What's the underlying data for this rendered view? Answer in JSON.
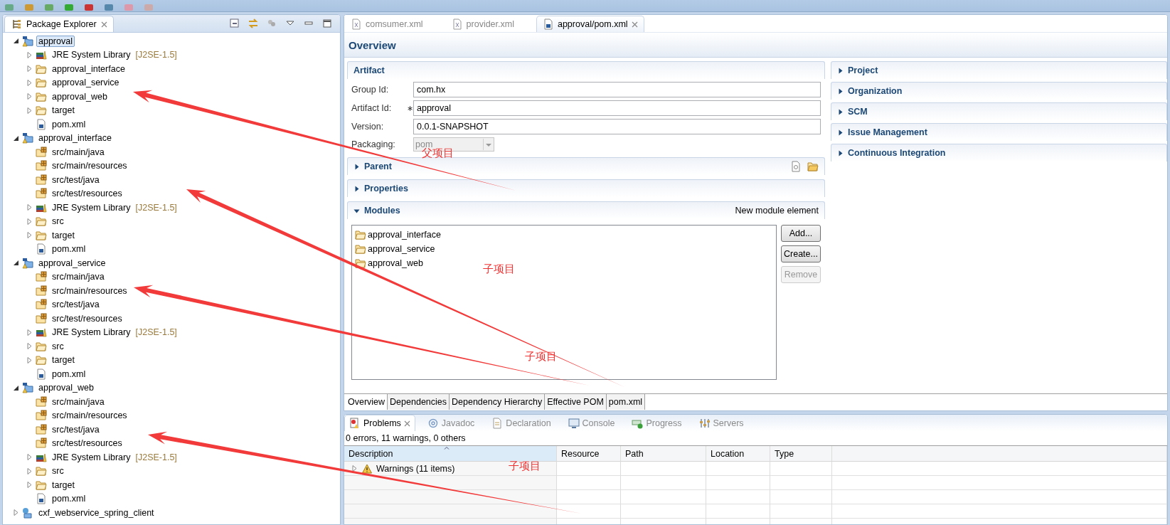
{
  "package_explorer": {
    "title": "Package Explorer",
    "tree": [
      {
        "label": "approval",
        "kind": "project",
        "expanded": true,
        "selected": true,
        "children": [
          {
            "label": "JRE System Library",
            "suffix": "[J2SE-1.5]",
            "kind": "library",
            "expanded": false
          },
          {
            "label": "approval_interface",
            "kind": "folder",
            "expanded": false
          },
          {
            "label": "approval_service",
            "kind": "folder",
            "expanded": false
          },
          {
            "label": "approval_web",
            "kind": "folder",
            "expanded": false
          },
          {
            "label": "target",
            "kind": "folder",
            "expanded": false
          },
          {
            "label": "pom.xml",
            "kind": "pom"
          }
        ]
      },
      {
        "label": "approval_interface",
        "kind": "project",
        "expanded": true,
        "selected": false,
        "children": [
          {
            "label": "src/main/java",
            "kind": "source"
          },
          {
            "label": "src/main/resources",
            "kind": "source"
          },
          {
            "label": "src/test/java",
            "kind": "source"
          },
          {
            "label": "src/test/resources",
            "kind": "source"
          },
          {
            "label": "JRE System Library",
            "suffix": "[J2SE-1.5]",
            "kind": "library",
            "expanded": false
          },
          {
            "label": "src",
            "kind": "folder",
            "expanded": false
          },
          {
            "label": "target",
            "kind": "folder",
            "expanded": false
          },
          {
            "label": "pom.xml",
            "kind": "pom"
          }
        ]
      },
      {
        "label": "approval_service",
        "kind": "project",
        "expanded": true,
        "selected": false,
        "children": [
          {
            "label": "src/main/java",
            "kind": "source"
          },
          {
            "label": "src/main/resources",
            "kind": "source"
          },
          {
            "label": "src/test/java",
            "kind": "source"
          },
          {
            "label": "src/test/resources",
            "kind": "source"
          },
          {
            "label": "JRE System Library",
            "suffix": "[J2SE-1.5]",
            "kind": "library",
            "expanded": false
          },
          {
            "label": "src",
            "kind": "folder",
            "expanded": false
          },
          {
            "label": "target",
            "kind": "folder",
            "expanded": false
          },
          {
            "label": "pom.xml",
            "kind": "pom"
          }
        ]
      },
      {
        "label": "approval_web",
        "kind": "project",
        "expanded": true,
        "selected": false,
        "children": [
          {
            "label": "src/main/java",
            "kind": "source"
          },
          {
            "label": "src/main/resources",
            "kind": "source"
          },
          {
            "label": "src/test/java",
            "kind": "source"
          },
          {
            "label": "src/test/resources",
            "kind": "source"
          },
          {
            "label": "JRE System Library",
            "suffix": "[J2SE-1.5]",
            "kind": "library",
            "expanded": false
          },
          {
            "label": "src",
            "kind": "folder",
            "expanded": false
          },
          {
            "label": "target",
            "kind": "folder",
            "expanded": false
          },
          {
            "label": "pom.xml",
            "kind": "pom"
          }
        ]
      },
      {
        "label": "cxf_webservice_spring_client",
        "kind": "webproject",
        "expanded": false,
        "selected": false
      }
    ]
  },
  "editor": {
    "tabs": [
      {
        "label": "comsumer.xml",
        "kind": "xml",
        "selected": false
      },
      {
        "label": "provider.xml",
        "kind": "xml",
        "selected": false
      },
      {
        "label": "approval/pom.xml",
        "kind": "pom",
        "selected": true
      }
    ],
    "heading": "Overview",
    "artifact": {
      "title": "Artifact",
      "fields": [
        {
          "label": "Group Id:",
          "value": "com.hx"
        },
        {
          "label": "Artifact Id:",
          "value": "approval",
          "marker": "∗"
        },
        {
          "label": "Version:",
          "value": "0.0.1-SNAPSHOT"
        }
      ],
      "packaging": {
        "label": "Packaging:",
        "value": "pom",
        "disabled": true
      }
    },
    "sections": [
      {
        "title": "Parent",
        "expanded": false,
        "kind": "parent"
      },
      {
        "title": "Properties",
        "expanded": false,
        "kind": "plain"
      }
    ],
    "modules": {
      "title": "Modules",
      "expanded": true,
      "action": "New module element",
      "items": [
        "approval_interface",
        "approval_service",
        "approval_web"
      ],
      "buttons": [
        {
          "label": "Add...",
          "disabled": false
        },
        {
          "label": "Create...",
          "disabled": false
        },
        {
          "label": "Remove",
          "disabled": true
        }
      ]
    },
    "side_sections": [
      {
        "title": "Project",
        "expanded": false
      },
      {
        "title": "Organization",
        "expanded": false
      },
      {
        "title": "SCM",
        "expanded": false
      },
      {
        "title": "Issue Management",
        "expanded": false
      },
      {
        "title": "Continuous Integration",
        "expanded": false
      }
    ],
    "page_tabs": [
      {
        "label": "Overview",
        "selected": true
      },
      {
        "label": "Dependencies",
        "selected": false
      },
      {
        "label": "Dependency Hierarchy",
        "selected": false
      },
      {
        "label": "Effective POM",
        "selected": false
      },
      {
        "label": "pom.xml",
        "selected": false
      }
    ]
  },
  "bottom_panel": {
    "tabs": [
      {
        "label": "Problems",
        "kind": "problems",
        "selected": true
      },
      {
        "label": "Javadoc",
        "kind": "javadoc",
        "selected": false
      },
      {
        "label": "Declaration",
        "kind": "declaration",
        "selected": false
      },
      {
        "label": "Console",
        "kind": "console",
        "selected": false
      },
      {
        "label": "Progress",
        "kind": "progress",
        "selected": false
      },
      {
        "label": "Servers",
        "kind": "servers",
        "selected": false
      }
    ],
    "summary": "0 errors, 11 warnings, 0 others",
    "columns": [
      "Description",
      "Resource",
      "Path",
      "Location",
      "Type"
    ],
    "rows": [
      {
        "label": "Warnings (11 items)",
        "kind": "warning",
        "expanded": false
      }
    ]
  },
  "annotations": [
    {
      "text": "父项目"
    },
    {
      "text": "子项目"
    },
    {
      "text": "子项目"
    },
    {
      "text": "子项目"
    }
  ]
}
